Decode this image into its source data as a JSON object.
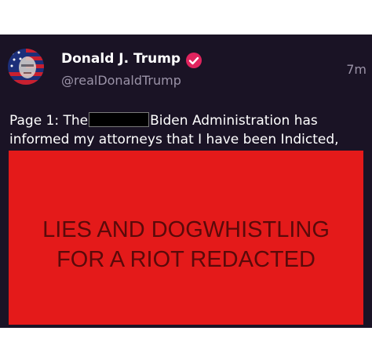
{
  "post": {
    "author_name": "Donald J. Trump",
    "handle": "@realDonaldTrump",
    "time": "7m",
    "text_line1_before": "Page 1: The",
    "text_line1_after": "Biden Administration has",
    "text_line2": "informed my attorneys that I have been Indicted,"
  },
  "overlay": {
    "line1": "LIES AND DOGWHISTLING",
    "line2": "FOR A RIOT REDACTED"
  },
  "colors": {
    "post_background": "#1a1325",
    "overlay_red": "#e41a1a",
    "overlay_text": "#5a0a0a",
    "verified_badge": "#e0245e"
  },
  "icons": {
    "avatar": "flag-portrait-avatar",
    "verified": "verified-badge-icon"
  }
}
